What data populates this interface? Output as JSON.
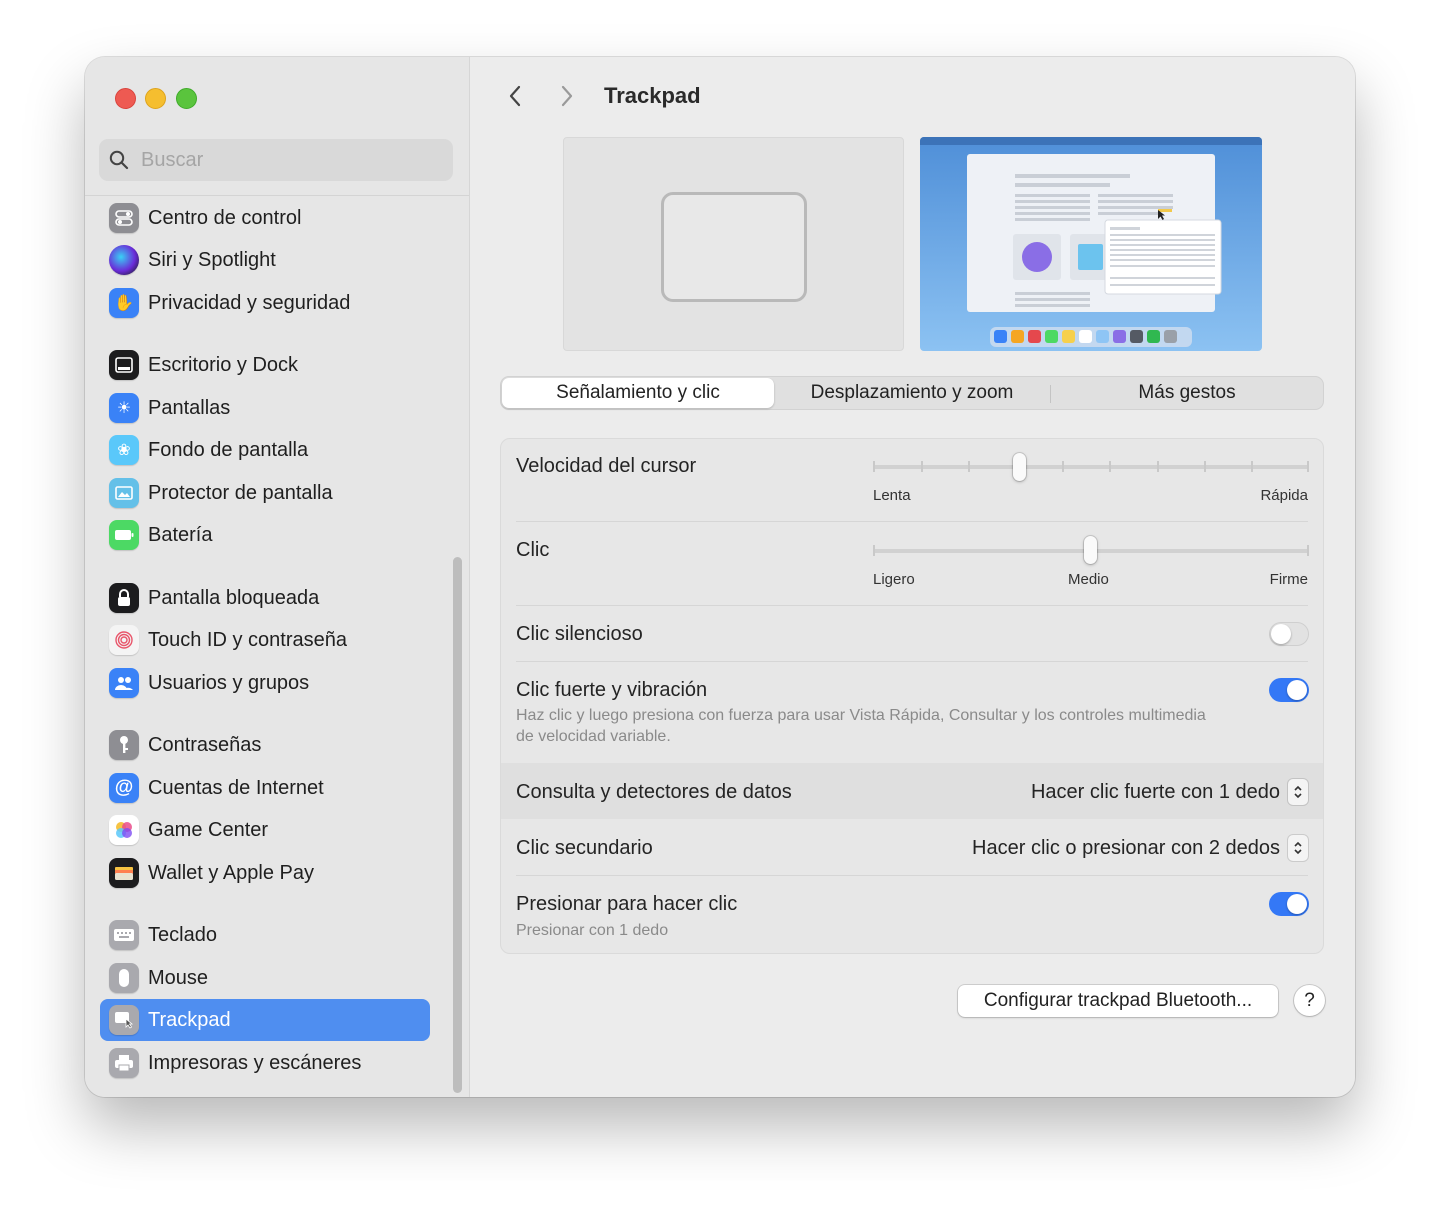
{
  "window": {
    "title": "Trackpad"
  },
  "search": {
    "placeholder": "Buscar",
    "icon": "search-icon"
  },
  "sidebar": {
    "items": [
      {
        "label": "Centro de control",
        "icon": "control-center-icon",
        "color": "#8e8e93"
      },
      {
        "label": "Siri y Spotlight",
        "icon": "siri-icon",
        "color": "#7a3cc8"
      },
      {
        "label": "Privacidad y seguridad",
        "icon": "hand-icon",
        "color": "#3a82f7"
      },
      {
        "label": "Escritorio y Dock",
        "icon": "dock-icon",
        "color": "#1c1c1e"
      },
      {
        "label": "Pantallas",
        "icon": "sun-icon",
        "color": "#3a82f7"
      },
      {
        "label": "Fondo de pantalla",
        "icon": "wallpaper-icon",
        "color": "#5ac8fa"
      },
      {
        "label": "Protector de pantalla",
        "icon": "screensaver-icon",
        "color": "#64c0e8"
      },
      {
        "label": "Batería",
        "icon": "battery-icon",
        "color": "#4cd964"
      },
      {
        "label": "Pantalla bloqueada",
        "icon": "lock-icon",
        "color": "#1c1c1e"
      },
      {
        "label": "Touch ID y contraseña",
        "icon": "fingerprint-icon",
        "color": "#f2f2f2"
      },
      {
        "label": "Usuarios y grupos",
        "icon": "users-icon",
        "color": "#3a82f7"
      },
      {
        "label": "Contraseñas",
        "icon": "key-icon",
        "color": "#8e8e93"
      },
      {
        "label": "Cuentas de Internet",
        "icon": "at-icon",
        "color": "#3a82f7"
      },
      {
        "label": "Game Center",
        "icon": "game-center-icon",
        "color": "#ffffff"
      },
      {
        "label": "Wallet y Apple Pay",
        "icon": "wallet-icon",
        "color": "#1c1c1e"
      },
      {
        "label": "Teclado",
        "icon": "keyboard-icon",
        "color": "#a9a9ae"
      },
      {
        "label": "Mouse",
        "icon": "mouse-icon",
        "color": "#a9a9ae"
      },
      {
        "label": "Trackpad",
        "icon": "trackpad-icon",
        "color": "#a9a9ae",
        "selected": true
      },
      {
        "label": "Impresoras y escáneres",
        "icon": "printer-icon",
        "color": "#a9a9ae"
      }
    ]
  },
  "nav": {
    "back_icon": "chevron-left-icon",
    "forward_icon": "chevron-right-icon"
  },
  "tabs": [
    {
      "label": "Señalamiento y clic",
      "active": true
    },
    {
      "label": "Desplazamiento y zoom",
      "active": false
    },
    {
      "label": "Más gestos",
      "active": false
    }
  ],
  "settings": {
    "cursor_speed": {
      "label": "Velocidad del cursor",
      "min_label": "Lenta",
      "max_label": "Rápida",
      "ticks": 10,
      "value_index": 3
    },
    "click": {
      "label": "Clic",
      "labels": [
        "Ligero",
        "Medio",
        "Firme"
      ],
      "value_index": 1
    },
    "silent_click": {
      "label": "Clic silencioso",
      "on": false
    },
    "force_click": {
      "label": "Clic fuerte y vibración",
      "description": "Haz clic y luego presiona con fuerza para usar Vista Rápida, Consultar y los controles multimedia de velocidad variable.",
      "on": true
    },
    "lookup": {
      "label": "Consulta y detectores de datos",
      "value": "Hacer clic fuerte con 1 dedo"
    },
    "secondary_click": {
      "label": "Clic secundario",
      "value": "Hacer clic o presionar con 2 dedos"
    },
    "tap_to_click": {
      "label": "Presionar para hacer clic",
      "description": "Presionar con 1 dedo",
      "on": true
    }
  },
  "buttons": {
    "bluetooth": "Configurar trackpad Bluetooth...",
    "help": "?"
  },
  "colors": {
    "accent": "#3478f6",
    "selection": "#4f8ef0"
  }
}
